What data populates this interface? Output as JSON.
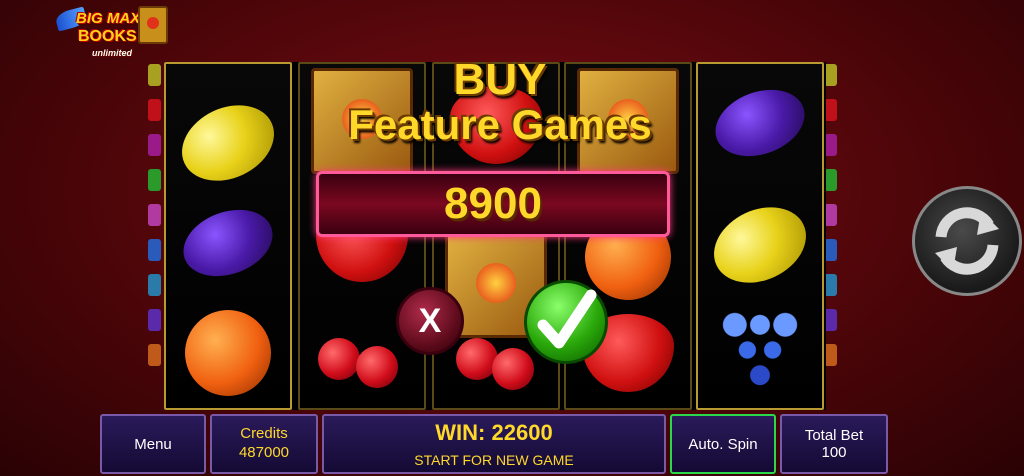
{
  "logo": {
    "line1": "BIG MAX",
    "line2": "BOOKS",
    "line3": "unlimited"
  },
  "dialog": {
    "title_line1": "BUY",
    "title_line2": "Feature Games",
    "price": "8900",
    "cancel_label": "X"
  },
  "bottom_bar": {
    "menu_label": "Menu",
    "credits_label": "Credits",
    "credits_value": "487000",
    "win_label": "WIN: 22600",
    "start_label": "START FOR NEW GAME",
    "autospin_label": "Auto. Spin",
    "total_bet_label": "Total Bet",
    "total_bet_value": "100"
  },
  "colors": {
    "accent_gold": "#ffd82a",
    "background": "#4a0508",
    "ok_green": "#2aa80a",
    "bar_blue": "#2a1a5a"
  },
  "icons": [
    "spin-icon",
    "check-icon"
  ]
}
